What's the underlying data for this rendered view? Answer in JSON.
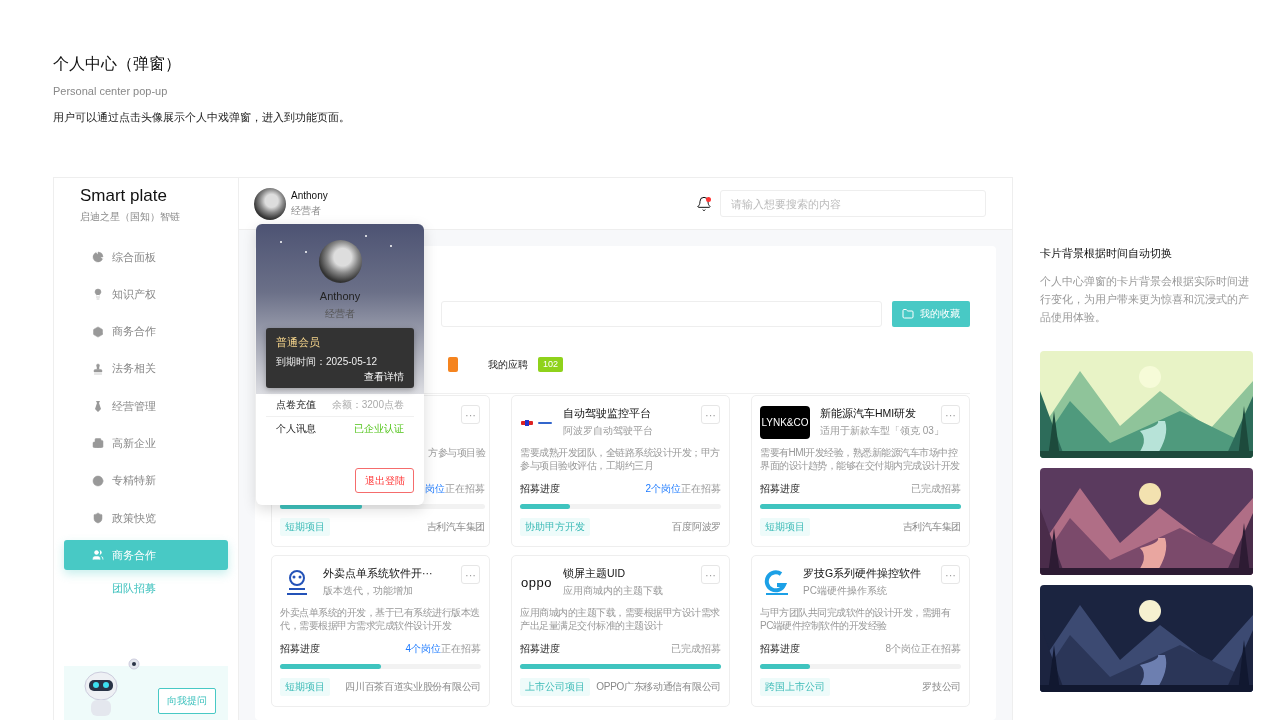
{
  "page": {
    "title": "个人中心（弹窗）",
    "subtitle": "Personal center pop-up",
    "description": "用户可以通过点击头像展示个人中戏弹窗，进入到功能页面。"
  },
  "sidebar": {
    "brand": "Smart plate",
    "brand_sub": "启迪之星（国知）智链",
    "items": [
      {
        "label": "综合面板",
        "selected": false
      },
      {
        "label": "知识产权",
        "selected": false
      },
      {
        "label": "商务合作",
        "selected": false
      },
      {
        "label": "法务相关",
        "selected": false
      },
      {
        "label": "经营管理",
        "selected": false
      },
      {
        "label": "高新企业",
        "selected": false
      },
      {
        "label": "专精特新",
        "selected": false
      },
      {
        "label": "政策快览",
        "selected": false
      },
      {
        "label": "商务合作",
        "selected": true
      }
    ],
    "sub_items": [
      {
        "label": "团队招募",
        "selected": true
      }
    ],
    "ask_button": "向我提问"
  },
  "header": {
    "user_name": "Anthony",
    "user_role": "经营者",
    "notification": true,
    "search_placeholder": "请输入想要搜索的内容"
  },
  "toolbar": {
    "favorites_button": "我的收藏"
  },
  "tabs": [
    {
      "color": "#f5841f"
    },
    {
      "label": "我的应聘",
      "count": "102",
      "color": "#8fd21b"
    }
  ],
  "cards": [
    {
      "more": "···",
      "desc": "方参与项目验",
      "status_count": "岗位",
      "status_text": "正在招募",
      "level": 0.4,
      "tag": "短期项目",
      "company": "吉利汽车集团"
    },
    {
      "more": "···",
      "logo": {
        "kind": "apollo"
      },
      "title": "自动驾驶监控平台",
      "subtitle": "阿波罗自动驾驶平台",
      "desc": "需要成熟开发团队，全链路系统设计开发；甲方参与项目验收评估，工期约三月",
      "progress_label": "招募进度",
      "status_count": "2个岗位",
      "status_text": "正在招募",
      "level": 0.25,
      "tag": "协助甲方开发",
      "company": "百度阿波罗"
    },
    {
      "more": "···",
      "logo": {
        "kind": "wordmark",
        "text": "LYNK&CO"
      },
      "title": "新能源汽车HMI研发",
      "subtitle": "适用于新款车型「领克 03」",
      "desc": "需要有HMI开发经验，熟悉新能源汽车市场中控界面的设计趋势，能够在交付期内完成设计开发",
      "progress_label": "招募进度",
      "status_text": "已完成招募",
      "level": 1,
      "tag": "短期项目",
      "company": "吉利汽车集团"
    },
    {
      "more": "···",
      "logo": {
        "kind": "tea"
      },
      "title": "外卖点单系统软件开···",
      "subtitle": "版本迭代，功能增加",
      "desc": "外卖点单系统的开发，基于已有系统进行版本迭代，需要根据甲方需求完成软件设计开发",
      "progress_label": "招募进度",
      "status_count": "4个岗位",
      "status_text": "正在招募",
      "level": 0.5,
      "tag": "短期项目",
      "company": "四川百茶百道实业股份有限公司"
    },
    {
      "more": "···",
      "logo": {
        "kind": "text",
        "text": "oppo"
      },
      "title": "锁屏主题UID",
      "subtitle": "应用商城内的主题下载",
      "desc": "应用商城内的主题下载，需要根据甲方设计需求产出足量满足交付标准的主题设计",
      "progress_label": "招募进度",
      "status_text": "已完成招募",
      "level": 1,
      "tag": "上市公司项目",
      "company": "OPPO广东移动通信有限公司"
    },
    {
      "more": "···",
      "logo": {
        "kind": "g"
      },
      "title": "罗技G系列硬件操控软件",
      "subtitle": "PC端硬件操作系统",
      "desc": "与甲方团队共同完成软件的设计开发，需拥有PC端硬件控制软件的开发经验",
      "progress_label": "招募进度",
      "status_text": "8个岗位正在招募",
      "level": 0.25,
      "tag": "跨国上市公司",
      "company": "罗技公司"
    }
  ],
  "popup": {
    "name": "Anthony",
    "role": "经营者",
    "membership": {
      "title": "普通会员",
      "expiry": "到期时间：2025-05-12",
      "details_link": "查看详情"
    },
    "rows": [
      {
        "label": "点卷充值",
        "value": "余额：3200点卷",
        "kind": "muted"
      },
      {
        "label": "个人讯息",
        "value": "已企业认证",
        "kind": "success"
      }
    ],
    "logout_button": "退出登陆"
  },
  "aside": {
    "heading": "卡片背景根据时间自动切换",
    "text": "个人中心弹窗的卡片背景会根据实际时间进行变化，为用户带来更为惊喜和沉浸式的产品使用体验。"
  }
}
